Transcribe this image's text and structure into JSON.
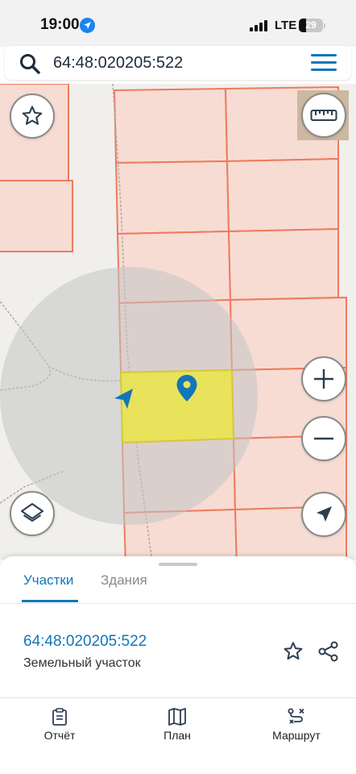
{
  "status": {
    "time": "19:00",
    "network": "LTE",
    "battery": "29",
    "battery_level": 0.29
  },
  "search": {
    "query": "64:48:020205:522",
    "search_icon": "search-icon",
    "menu_icon": "hamburger-menu-icon"
  },
  "map": {
    "colors": {
      "parcel_fill": "#f7dcd4",
      "parcel_border": "#ee7b5c",
      "selected_fill": "#e8e35a",
      "selected_border": "#d6c93c",
      "accuracy_circle": "#c4c4c4",
      "accent": "#1276b8"
    },
    "controls": {
      "favorite": "star-icon",
      "ruler": "ruler-icon",
      "zoom_in": "plus-icon",
      "zoom_out": "minus-icon",
      "layers": "layers-icon",
      "my_location": "navigation-arrow-icon"
    }
  },
  "sheet": {
    "tabs": [
      "Участки",
      "Здания"
    ],
    "active_tab": "Участки",
    "plot": {
      "number": "64:48:020205:522",
      "type": "Земельный участок"
    }
  },
  "bottom_nav": {
    "report": "Отчёт",
    "plan": "План",
    "route": "Маршрут"
  }
}
